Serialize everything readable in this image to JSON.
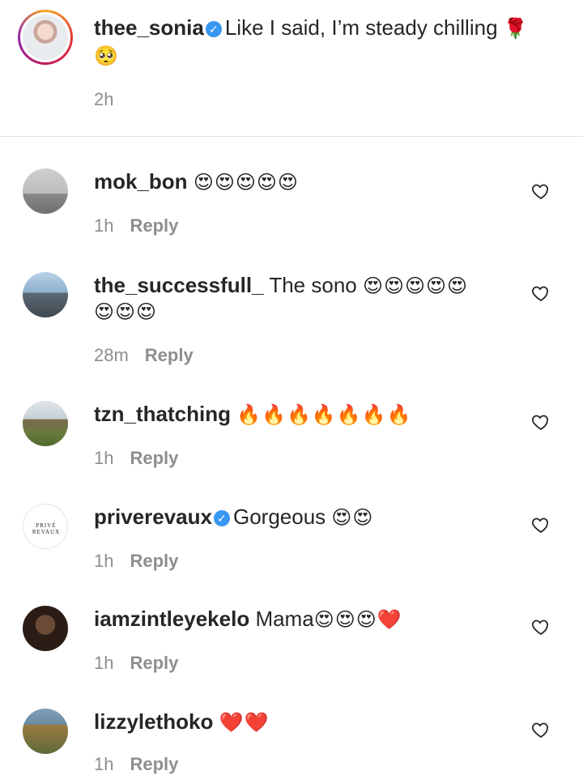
{
  "caption": {
    "username": "thee_sonia",
    "verified": true,
    "text": "Like I said, I’m steady chilling",
    "emoji_line1": "🌹",
    "emoji_line2": "🥺",
    "time": "2h"
  },
  "comments": [
    {
      "username": "mok_bon",
      "text": "",
      "emojis": "😍😍😍😍😍",
      "time": "1h",
      "reply": "Reply"
    },
    {
      "username": "the_successfull_",
      "text": "The sono",
      "emojis": "😍😍😍😍😍",
      "emojis2": "😍😍😍",
      "time": "28m",
      "reply": "Reply"
    },
    {
      "username": "tzn_thatching",
      "text": "",
      "emojis": "🔥🔥🔥🔥🔥🔥🔥",
      "time": "1h",
      "reply": "Reply"
    },
    {
      "username": "priverevaux",
      "verified": true,
      "text": "Gorgeous",
      "emojis": "😍😍",
      "time": "1h",
      "reply": "Reply",
      "avatar_text": "PRIVÉ REVAUX"
    },
    {
      "username": "iamzintleyekelo",
      "text": "Mama",
      "emojis": "😍😍😍❤️",
      "time": "1h",
      "reply": "Reply"
    },
    {
      "username": "lizzylethoko",
      "text": "",
      "emojis": "❤️❤️",
      "time": "1h",
      "reply": "Reply"
    }
  ],
  "icons": {
    "verified": "verified-badge-icon",
    "like": "heart-outline-icon"
  },
  "colors": {
    "text": "#262626",
    "secondary": "#8e8e8e",
    "verified": "#3897f0",
    "divider": "#e4e4e4"
  }
}
